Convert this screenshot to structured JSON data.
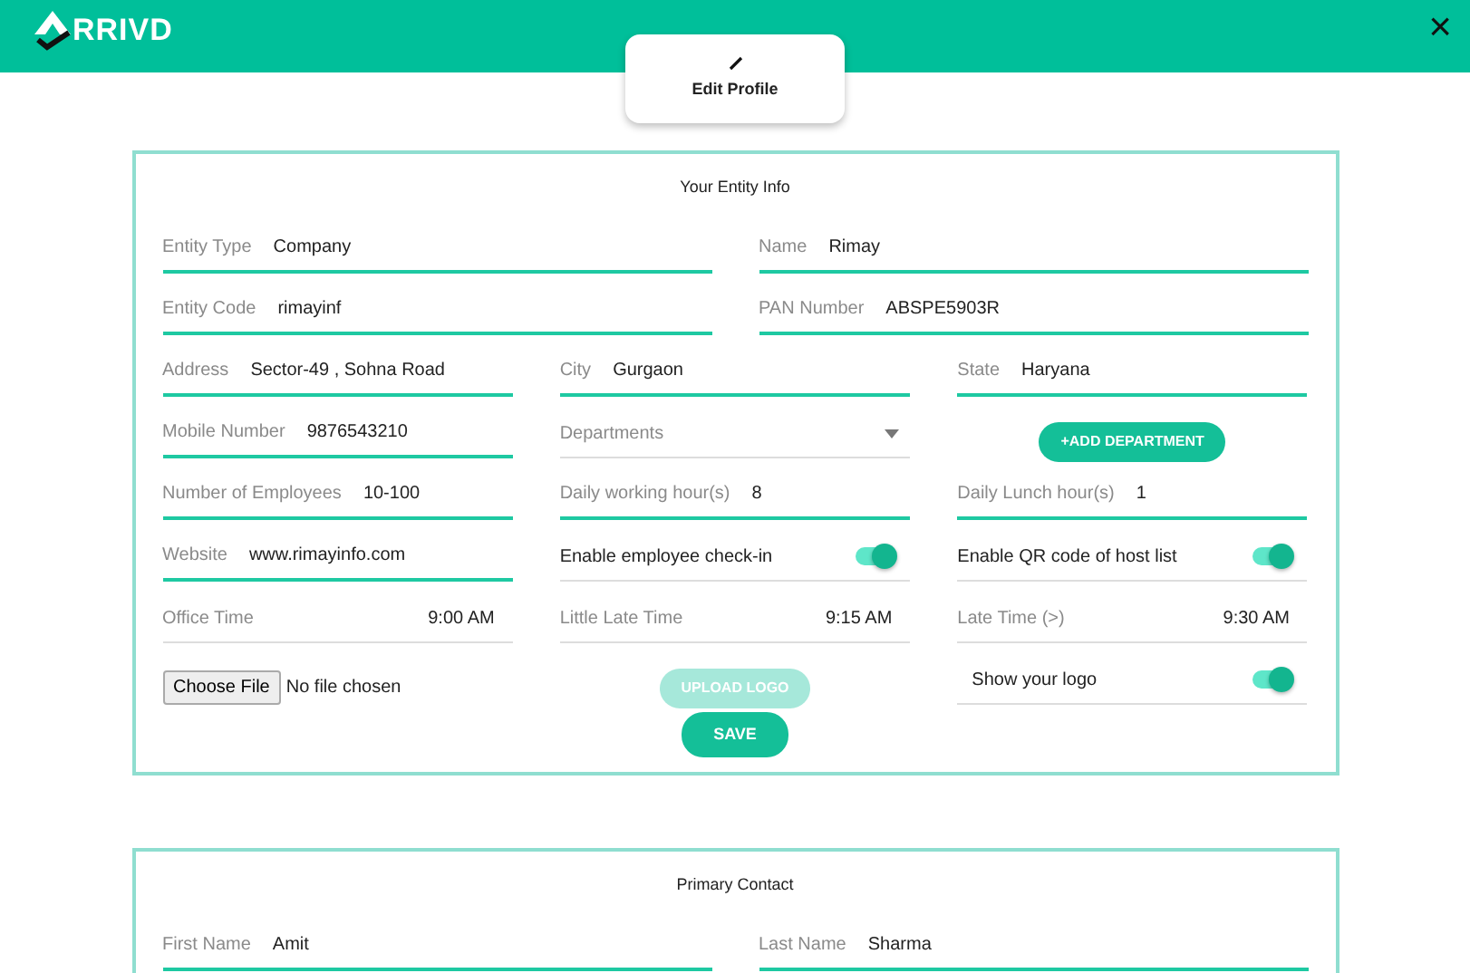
{
  "header": {
    "logo": "RRIVD",
    "close": "×"
  },
  "edit_profile": {
    "label": "Edit Profile"
  },
  "entity_info": {
    "title": "Your Entity Info",
    "rows": [
      [
        {
          "kind": "text",
          "label": "Entity Type",
          "value": "Company"
        },
        {
          "kind": "text",
          "label": "Name",
          "value": "Rimay"
        }
      ],
      [
        {
          "kind": "text",
          "label": "Entity Code",
          "value": "rimayinf"
        },
        {
          "kind": "text",
          "label": "PAN Number",
          "value": "ABSPE5903R"
        }
      ],
      [
        {
          "kind": "text",
          "label": "Address",
          "value": "Sector-49 , Sohna Road"
        },
        {
          "kind": "text",
          "label": "City",
          "value": "Gurgaon"
        },
        {
          "kind": "text",
          "label": "State",
          "value": "Haryana"
        }
      ],
      [
        {
          "kind": "text",
          "label": "Mobile Number",
          "value": "9876543210"
        },
        {
          "kind": "select",
          "placeholder": "Departments"
        },
        {
          "kind": "button",
          "label": "+ADD DEPARTMENT",
          "disabled": false
        }
      ],
      [
        {
          "kind": "text",
          "label": "Number of Employees",
          "value": "10-100"
        },
        {
          "kind": "text",
          "label": "Daily working hour(s)",
          "value": "8"
        },
        {
          "kind": "text",
          "label": "Daily Lunch hour(s)",
          "value": "1"
        }
      ],
      [
        {
          "kind": "text",
          "label": "Website",
          "value": "www.rimayinfo.com"
        },
        {
          "kind": "toggle",
          "label": "Enable employee check-in",
          "on": true
        },
        {
          "kind": "toggle",
          "label": "Enable QR code of host list",
          "on": true
        }
      ],
      [
        {
          "kind": "time",
          "label": "Office Time",
          "value": "9:00 AM"
        },
        {
          "kind": "time",
          "label": "Little Late Time",
          "value": "9:15 AM"
        },
        {
          "kind": "time",
          "label": "Late Time (>)",
          "value": "9:30 AM"
        }
      ],
      [
        {
          "kind": "file",
          "button": "Choose File",
          "status": "No file chosen"
        },
        {
          "kind": "button",
          "label": "UPLOAD LOGO",
          "disabled": true
        },
        {
          "kind": "toggle",
          "label": "Show your logo",
          "on": true
        }
      ]
    ],
    "save": "SAVE"
  },
  "primary_contact": {
    "title": "Primary Contact",
    "rows": [
      [
        {
          "kind": "text",
          "label": "First Name",
          "value": "Amit"
        },
        {
          "kind": "text",
          "label": "Last Name",
          "value": "Sharma"
        }
      ]
    ]
  }
}
